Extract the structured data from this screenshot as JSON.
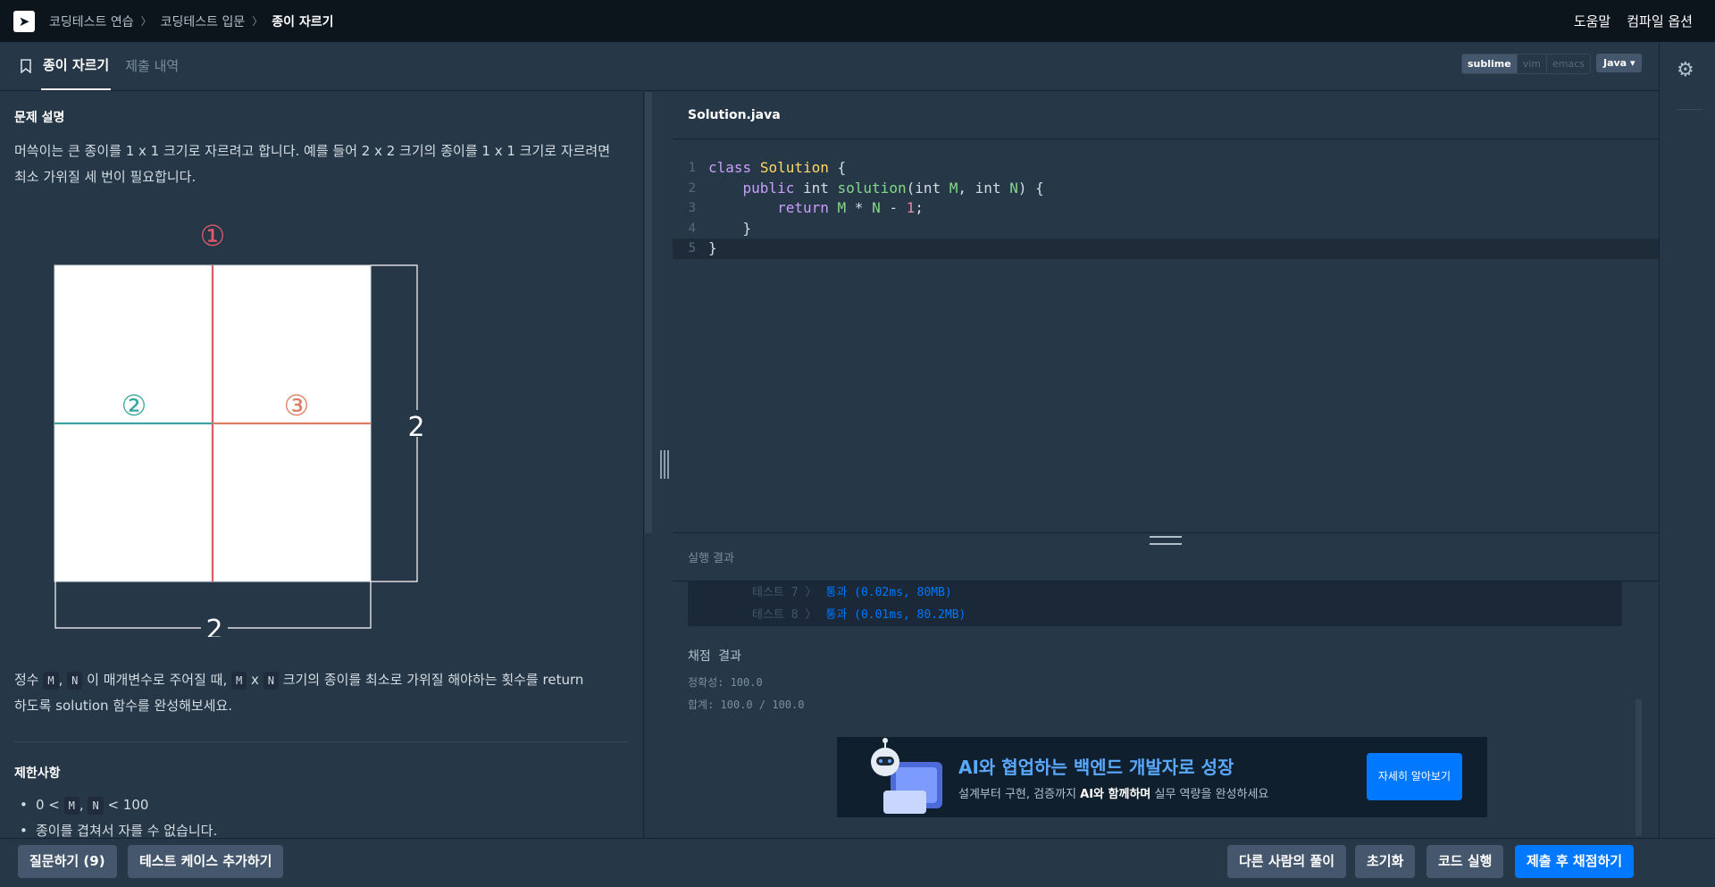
{
  "breadcrumb": {
    "items": [
      "코딩테스트 연습",
      "코딩테스트 입문",
      "종이 자르기"
    ]
  },
  "top_links": {
    "help": "도움말",
    "compile_options": "컴파일 옵션"
  },
  "tabs": {
    "problem": "종이 자르기",
    "submissions": "제출 내역"
  },
  "editor_modes": [
    "sublime",
    "vim",
    "emacs"
  ],
  "language": "Java",
  "problem": {
    "section_title": "문제 설명",
    "desc_line1": "머쓱이는 큰 종이를 1 x 1 크기로 자르려고 합니다. 예를 들어 2 x 2 크기의 종이를 1 x 1 크기로 자르려면",
    "desc_line2": "최소 가위질 세 번이 필요합니다.",
    "figure": {
      "cut1": "①",
      "cut2": "②",
      "cut3": "③",
      "side_right": "2",
      "side_bottom": "2"
    },
    "para2": {
      "p1": "정수 ",
      "m": "M",
      "comma": ", ",
      "n": "N",
      "p2": " 이 매개변수로 주어질 때, ",
      "m2": "M",
      "x": "x",
      "n2": "N",
      "p3": " 크기의 종이를 최소로 가위질 해야하는 횟수를 return",
      "line2": "하도록 solution 함수를 완성해보세요."
    },
    "constraints_title": "제한사항",
    "constraint1": {
      "a": "0 < ",
      "m": "M",
      "comma": ", ",
      "n": "N",
      "b": " < 100"
    },
    "constraint2": "종이를 겹쳐서 자를 수 없습니다."
  },
  "editor": {
    "filename": "Solution.java",
    "line_numbers": [
      "1",
      "2",
      "3",
      "4",
      "5"
    ]
  },
  "output": {
    "title": "실행 결과",
    "tests": [
      {
        "label": "테스트 7 〉",
        "result": "통과 (0.02ms, 80MB)"
      },
      {
        "label": "테스트 8 〉",
        "result": "통과 (0.01ms, 80.2MB)"
      }
    ],
    "grade_title": "채점 결과",
    "accuracy": "정확성: 100.0",
    "total": "합계: 100.0 / 100.0"
  },
  "banner": {
    "title": "AI와 협업하는 백엔드 개발자로 성장",
    "sub_a": "설계부터 구현, 검증까지 ",
    "sub_b": "AI와 함께하며",
    "sub_c": " 실무 역량을 완성하세요",
    "button": "자세히 알아보기"
  },
  "buttons": {
    "ask": "질문하기 (9)",
    "add_test": "테스트 케이스 추가하기",
    "others": "다른 사람의 풀이",
    "reset": "초기화",
    "run": "코드 실행",
    "submit": "제출 후 채점하기"
  },
  "colors": {
    "accent": "#0078ff",
    "cut_red": "#e05a6a",
    "cut_teal": "#3ba6a0",
    "cut_orange": "#e07d62"
  }
}
